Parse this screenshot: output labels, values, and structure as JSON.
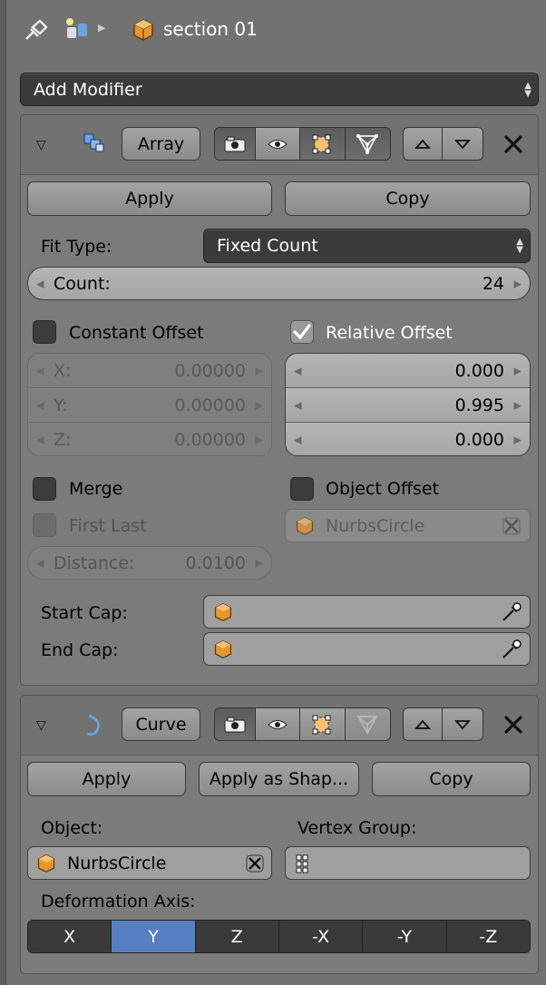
{
  "header": {
    "breadcrumb_label": "section 01"
  },
  "add_modifier": {
    "label": "Add Modifier"
  },
  "array": {
    "name": "Array",
    "apply": "Apply",
    "copy": "Copy",
    "fit_type_label": "Fit Type:",
    "fit_type_value": "Fixed Count",
    "count_label": "Count:",
    "count_value": "24",
    "constant_offset": {
      "label": "Constant Offset",
      "checked": false
    },
    "relative_offset": {
      "label": "Relative Offset",
      "checked": true
    },
    "constant": {
      "x_label": "X:",
      "x": "0.00000",
      "y_label": "Y:",
      "y": "0.00000",
      "z_label": "Z:",
      "z": "0.00000"
    },
    "relative": {
      "x": "0.000",
      "y": "0.995",
      "z": "0.000"
    },
    "merge": {
      "label": "Merge",
      "checked": false
    },
    "object_offset": {
      "label": "Object Offset",
      "checked": false
    },
    "first_last": {
      "label": "First Last",
      "checked": false
    },
    "offset_object": "NurbsCircle",
    "distance_label": "Distance:",
    "distance_value": "0.0100",
    "start_cap_label": "Start Cap:",
    "end_cap_label": "End Cap:"
  },
  "curve": {
    "name": "Curve",
    "apply": "Apply",
    "apply_shape": "Apply as Shap...",
    "copy": "Copy",
    "object_label": "Object:",
    "vertex_group_label": "Vertex Group:",
    "object_value": "NurbsCircle",
    "deform_axis_label": "Deformation Axis:",
    "axes": [
      "X",
      "Y",
      "Z",
      "-X",
      "-Y",
      "-Z"
    ],
    "selected_axis": "Y"
  },
  "colors": {
    "background": "#727272",
    "panel": "#7b7b7b",
    "selected_axis": "#5680c2",
    "object_icon": "#e8962e"
  },
  "icons": [
    "pin-icon",
    "object-data-icon",
    "object-cube-icon",
    "array-modifier-icon",
    "curve-modifier-icon",
    "render-camera-icon",
    "eye-icon",
    "editmode-icon",
    "cage-icon",
    "up-icon",
    "down-icon",
    "close-icon",
    "eyedropper-icon",
    "vertex-group-icon"
  ]
}
